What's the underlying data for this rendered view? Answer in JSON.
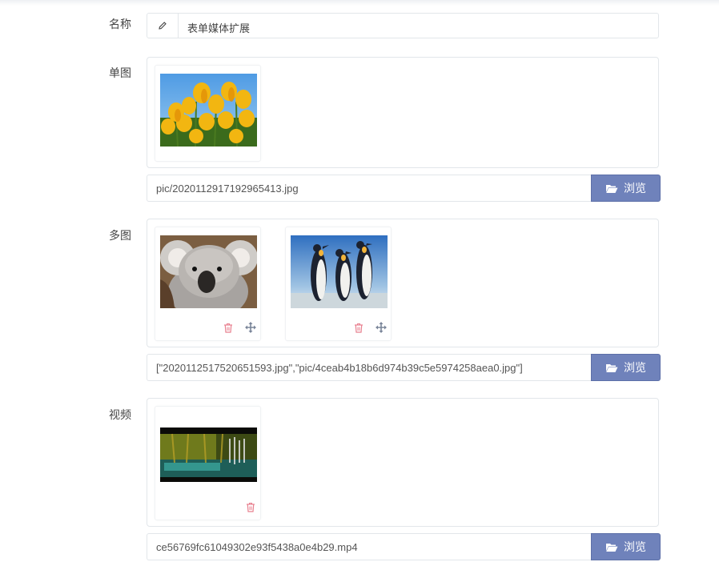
{
  "form": {
    "name": {
      "label": "名称",
      "value": "表单媒体扩展",
      "icon": "pencil-icon"
    },
    "single_image": {
      "label": "单图",
      "path": "pic/202011291719296541 3.jpg",
      "browse_label": "浏览",
      "images": [
        {
          "subject": "yellow tulips",
          "icon": "image"
        }
      ]
    },
    "multi_image": {
      "label": "多图",
      "path": "[\"2020112517520651593.jpg\",\"pic/4ceab4b18b6d974b39c5e5974258aea0.jpg\"]",
      "browse_label": "浏览",
      "images": [
        {
          "subject": "koala"
        },
        {
          "subject": "penguins"
        }
      ]
    },
    "video": {
      "label": "视频",
      "path": "ce56769fc61049302e93f5438a0e4b29.mp4",
      "browse_label": "浏览",
      "thumbnails": [
        {
          "subject": "forest video frame"
        }
      ]
    }
  },
  "colors": {
    "accent_button": "#6f82bb",
    "delete_icon": "#e8808f",
    "move_icon": "#7a8599",
    "border": "#e2e6ea"
  }
}
